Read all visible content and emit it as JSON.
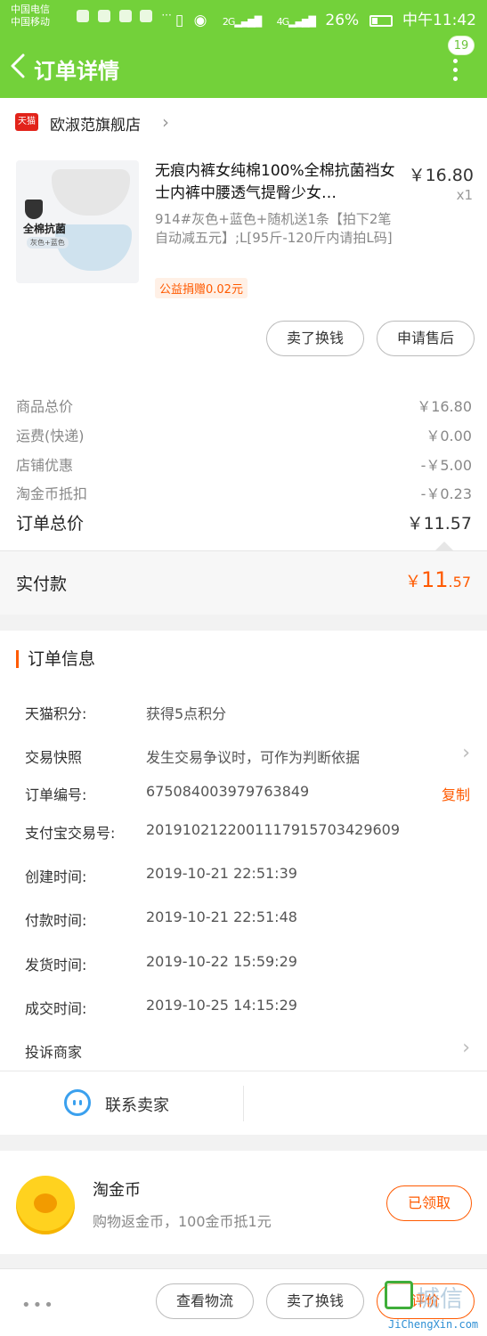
{
  "status_bar": {
    "carrier1": "中国电信",
    "carrier2": "中国移动",
    "more": "···",
    "net1": "2G",
    "net2": "4G",
    "battery": "26%",
    "time": "中午11:42"
  },
  "nav": {
    "title": "订单详情",
    "badge": "19",
    "icons": [
      "back-chevron-icon",
      "more-vertical-icon"
    ]
  },
  "store": {
    "badge_label": "天猫",
    "name": "欧淑范旗舰店"
  },
  "item": {
    "title": "无痕内裤女纯棉100%全棉抗菌裆女士内裤中腰透气提臀少女…",
    "price": "￥16.80",
    "qty": "x1",
    "sku": "914#灰色+蓝色+随机送1条【拍下2笔自动减五元】;L[95斤-120斤内请拍L码]",
    "charity": "公益捐赠0.02元",
    "thumb_label": "全棉抗菌",
    "thumb_tag": "灰色+蓝色",
    "actions": [
      "卖了换钱",
      "申请售后"
    ]
  },
  "summary": {
    "rows": [
      {
        "label": "商品总价",
        "value": "￥16.80"
      },
      {
        "label": "运费(快递)",
        "value": "￥0.00"
      },
      {
        "label": "店铺优惠",
        "value": "-￥5.00"
      },
      {
        "label": "淘金币抵扣",
        "value": "-￥0.23"
      }
    ],
    "total_label": "订单总价",
    "total_value": "￥11.57",
    "paid_label": "实付款",
    "paid_currency": "￥",
    "paid_int": "11",
    "paid_dec": ".57"
  },
  "order_info": {
    "title": "订单信息",
    "rows": [
      {
        "label": "天猫积分:",
        "value": "获得5点积分"
      },
      {
        "label": "交易快照",
        "value": "发生交易争议时，可作为判断依据"
      },
      {
        "label": "订单编号:",
        "value": "675084003979763849"
      },
      {
        "label": "支付宝交易号:",
        "value": "2019102122001117915703429609"
      },
      {
        "label": "创建时间:",
        "value": "2019-10-21 22:51:39"
      },
      {
        "label": "付款时间:",
        "value": "2019-10-21 22:51:48"
      },
      {
        "label": "发货时间:",
        "value": "2019-10-22 15:59:29"
      },
      {
        "label": "成交时间:",
        "value": "2019-10-25 14:15:29"
      },
      {
        "label": "投诉商家",
        "value": ""
      }
    ],
    "copy": "复制",
    "contact": "联系卖家"
  },
  "coin": {
    "title": "淘金币",
    "desc": "购物返金币，100金币抵1元",
    "button": "已领取"
  },
  "bottom": {
    "more": "•••",
    "buttons": [
      "查看物流",
      "卖了换钱",
      "评价"
    ]
  },
  "watermark": {
    "cn": "城信",
    "url": "JiChengXin.com"
  },
  "colors": {
    "header_green": "#73d13a",
    "accent_orange": "#ff5a00",
    "tmall_red": "#e2231a"
  }
}
